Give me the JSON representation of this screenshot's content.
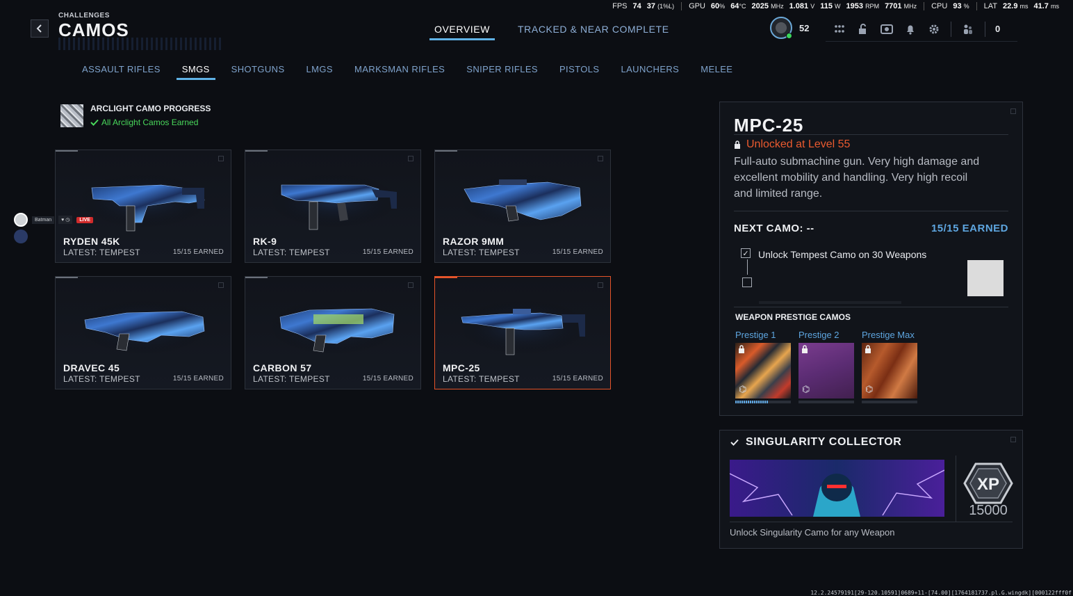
{
  "perf": {
    "fps_label": "FPS",
    "fps": "74",
    "fps_low": "37",
    "fps_low_unit": "(1%L)",
    "gpu_label": "GPU",
    "gpu_load": "60",
    "gpu_load_unit": "%",
    "gpu_temp": "64",
    "gpu_temp_unit": "°C",
    "gpu_clock": "2025",
    "gpu_clock_unit": "MHz",
    "gpu_volt": "1.081",
    "gpu_volt_unit": "V",
    "gpu_power": "115",
    "gpu_power_unit": "W",
    "gpu_fan": "1953",
    "gpu_fan_unit": "RPM",
    "gpu_mem": "7701",
    "gpu_mem_unit": "MHz",
    "cpu_label": "CPU",
    "cpu": "93",
    "cpu_unit": "%",
    "lat_label": "LAT",
    "lat1": "22.9",
    "lat1_unit": "ms",
    "lat2": "41.7",
    "lat2_unit": "ms"
  },
  "header": {
    "breadcrumb": "CHALLENGES",
    "title": "CAMOS",
    "tabs": [
      {
        "label": "OVERVIEW"
      },
      {
        "label": "TRACKED & NEAR COMPLETE"
      }
    ],
    "player_level": "52",
    "notification_count": "0"
  },
  "categories": [
    {
      "label": "ASSAULT RIFLES"
    },
    {
      "label": "SMGS"
    },
    {
      "label": "SHOTGUNS"
    },
    {
      "label": "LMGS"
    },
    {
      "label": "MARKSMAN RIFLES"
    },
    {
      "label": "SNIPER RIFLES"
    },
    {
      "label": "PISTOLS"
    },
    {
      "label": "LAUNCHERS"
    },
    {
      "label": "MELEE"
    }
  ],
  "arclight": {
    "title": "ARCLIGHT CAMO PROGRESS",
    "status": "All Arclight Camos Earned"
  },
  "weapons": [
    {
      "name": "RYDEN 45K",
      "latest": "LATEST: TEMPEST",
      "earned": "15/15 EARNED"
    },
    {
      "name": "RK-9",
      "latest": "LATEST: TEMPEST",
      "earned": "15/15 EARNED"
    },
    {
      "name": "RAZOR 9MM",
      "latest": "LATEST: TEMPEST",
      "earned": "15/15 EARNED"
    },
    {
      "name": "DRAVEC 45",
      "latest": "LATEST: TEMPEST",
      "earned": "15/15 EARNED"
    },
    {
      "name": "CARBON 57",
      "latest": "LATEST: TEMPEST",
      "earned": "15/15 EARNED"
    },
    {
      "name": "MPC-25",
      "latest": "LATEST: TEMPEST",
      "earned": "15/15 EARNED"
    }
  ],
  "stream": {
    "user": "Batman",
    "live": "LIVE"
  },
  "detail": {
    "name": "MPC-25",
    "unlock": "Unlocked at Level 55",
    "description": "Full-auto submachine gun. Very high damage and excellent mobility and handling. Very high recoil and limited range.",
    "next_camo": "NEXT CAMO: --",
    "earned": "15/15 EARNED",
    "task": "Unlock Tempest Camo on 30 Weapons",
    "prestige_title": "WEAPON PRESTIGE CAMOS",
    "prestige": [
      {
        "label": "Prestige 1",
        "progress": 0.6
      },
      {
        "label": "Prestige 2",
        "progress": 0
      },
      {
        "label": "Prestige Max",
        "progress": 0
      }
    ]
  },
  "singularity": {
    "title": "SINGULARITY COLLECTOR",
    "xp": "15000",
    "xp_badge": "XP",
    "description": "Unlock Singularity Camo for any Weapon"
  },
  "debug_text": "12.2.24579191[29-120.10591]0689+11-[74.00][1764181737.pl.G.wingdk][000122fff0f"
}
